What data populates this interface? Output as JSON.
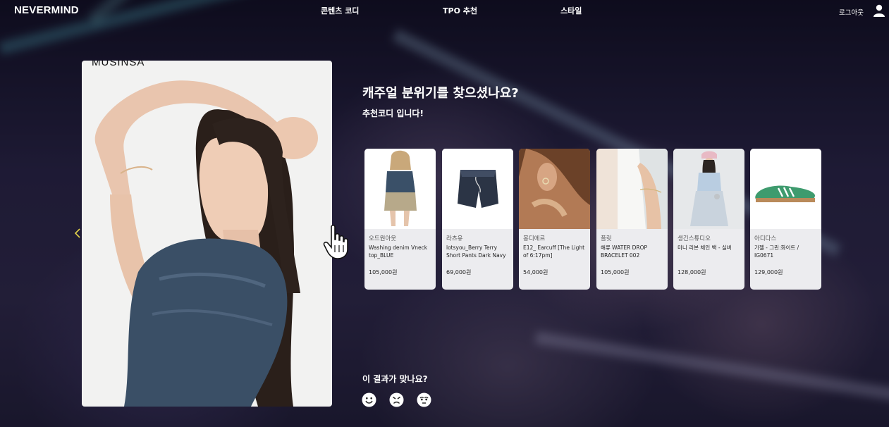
{
  "header": {
    "logo": "NEVERMIND",
    "nav": [
      "콘텐츠 코디",
      "TPO 추천",
      "스타일"
    ],
    "logout": "로그아웃",
    "user_icon": "user-icon"
  },
  "photo": {
    "brand": "MUSINSA"
  },
  "recommend": {
    "title": "캐주얼 분위기를 찾으셨나요?",
    "subtitle": "추천코디 입니다!"
  },
  "products": [
    {
      "brand": "오드원아웃",
      "name": "Washing denim Vneck top_BLUE",
      "price": "105,000원"
    },
    {
      "brand": "라츠유",
      "name": "lotsyou_Berry Terry Short Pants Dark Navy",
      "price": "69,000원"
    },
    {
      "brand": "몽디에르",
      "name": "E12_ Earcuff [The Light of 6:17pm]",
      "price": "54,000원"
    },
    {
      "brand": "플릿",
      "name": "해류 WATER DROP BRACELET 002",
      "price": "105,000원"
    },
    {
      "brand": "생긴스튜디오",
      "name": "미니 리본 체인 백 - 실버",
      "price": "128,000원"
    },
    {
      "brand": "아디다스",
      "name": "가젤 - 그린:화이트 / IG0671",
      "price": "129,000원"
    }
  ],
  "feedback": {
    "question": "이 결과가 맞나요?",
    "options": [
      "smile-face-icon",
      "angry-face-icon",
      "neutral-face-icon"
    ]
  },
  "colors": {
    "accent_arrow": "#e4d34a",
    "card_bg": "#ececef",
    "background": "#1d1930"
  }
}
